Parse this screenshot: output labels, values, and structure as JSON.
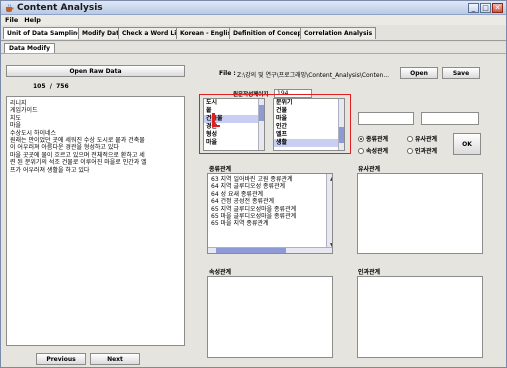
{
  "window": {
    "title": "Content Analysis",
    "minimize_glyph": "_",
    "maximize_glyph": "□",
    "close_glyph": "✕"
  },
  "menu": [
    "File",
    "Help"
  ],
  "tabs": [
    "Unit of Data Sampling",
    "Modify Data",
    "Check a Word List",
    "Korean - English",
    "Definition of Concept",
    "Correlation Analysis"
  ],
  "subtab": "Data Modify",
  "left": {
    "open_raw_button": "Open Raw Data",
    "counter_current": "105",
    "counter_sep": "/",
    "counter_total": "756",
    "text_lines": [
      "리니지",
      "게임가이드",
      "지도",
      "마을",
      "수상도시 하이네스",
      "원래는 만이었던 곳에 세워진 수상 도시로 뭍과 건축물",
      "이 어우러져 아름다운 경관을 형성하고 있다",
      "마을 곳곳에 물이 흐르고 있으며 전체적으로 환하고 세",
      "련 된 분위기의 석조 건물로 이루어진 마을로 인간과 엘",
      "프가 어우러져 생활을 하고 있다"
    ],
    "previous_button": "Previous",
    "next_button": "Next"
  },
  "file_row": {
    "label": "File :",
    "path": "Z:\\강의 및 연구\\프로그래밍\\Content_Analysis\\Conten...",
    "open_button": "Open",
    "save_button": "Save"
  },
  "page_field": {
    "label": "원문작성페이지",
    "value": "194"
  },
  "word_list_left": [
    "도시",
    "뭍",
    "건축물",
    "경관",
    "형성",
    "마을"
  ],
  "word_list_left_selected": 2,
  "word_list_right": [
    "분위기",
    "건물",
    "마을",
    "인간",
    "엘프",
    "생활"
  ],
  "word_list_right_selected": 5,
  "relation_options": {
    "row1": [
      "종류관계",
      "유사관계"
    ],
    "row2": [
      "속성관계",
      "인과관계"
    ],
    "selected": "종류관계",
    "ok_button": "OK"
  },
  "sections": {
    "kind": "종류관계",
    "similar": "유사관계",
    "attribute": "속성관계",
    "causal": "인과관계"
  },
  "kind_relations": [
    "63  지역  일어바린 고원  종류관계",
    "64  지역  글루디오성   종류관계",
    "64  성  요새  종류관계",
    "64  건정  공성전  종류관계",
    "65  지역  글루디오성마을  종류관계",
    "65  마을  글루디오성마을  종류관계",
    "65  마을  지역  종류관계"
  ],
  "colors": {
    "highlight_border": "#e02020",
    "selection": "#c8cff2",
    "scroll_thumb": "#8e9ad6"
  }
}
